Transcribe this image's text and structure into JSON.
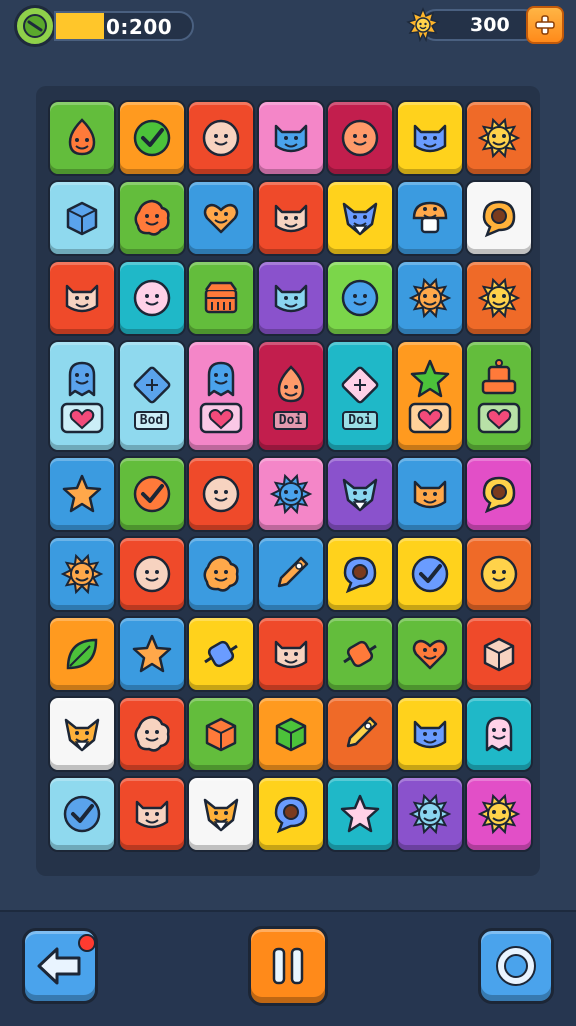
{
  "hud": {
    "timer_text": "0:200",
    "timer_progress": 0.35,
    "coins": "300"
  },
  "colors": {
    "green": "#63bd3c",
    "orange": "#ff9a1f",
    "red": "#ef4a2a",
    "pink": "#f486c8",
    "crimson": "#c21e4d",
    "yellow": "#ffd21c",
    "darkorange": "#ef6a28",
    "lightblue": "#8fd9ee",
    "blue": "#3b9be0",
    "white": "#f7f7f7",
    "teal": "#1fb8c8",
    "purple": "#8a52cc",
    "lime": "#7bd64a",
    "magenta": "#e24fc7"
  },
  "board": {
    "rows": [
      [
        {
          "c": "green",
          "i": "flame"
        },
        {
          "c": "orange",
          "i": "check"
        },
        {
          "c": "red",
          "i": "smile"
        },
        {
          "c": "pink",
          "i": "cat"
        },
        {
          "c": "crimson",
          "i": "smile"
        },
        {
          "c": "yellow",
          "i": "cat"
        },
        {
          "c": "darkorange",
          "i": "sun"
        }
      ],
      [
        {
          "c": "lightblue",
          "i": "box"
        },
        {
          "c": "green",
          "i": "blob"
        },
        {
          "c": "blue",
          "i": "heart"
        },
        {
          "c": "red",
          "i": "cat"
        },
        {
          "c": "yellow",
          "i": "fox"
        },
        {
          "c": "blue",
          "i": "mushroom"
        },
        {
          "c": "white",
          "i": "bubble"
        }
      ],
      [
        {
          "c": "red",
          "i": "cat"
        },
        {
          "c": "teal",
          "i": "smile"
        },
        {
          "c": "green",
          "i": "chest"
        },
        {
          "c": "purple",
          "i": "cat"
        },
        {
          "c": "lime",
          "i": "smile"
        },
        {
          "c": "blue",
          "i": "sun"
        },
        {
          "c": "darkorange",
          "i": "sun"
        }
      ],
      [
        {
          "c": "lightblue",
          "i": "ghost",
          "tall": true,
          "lbl": "heart"
        },
        {
          "c": "lightblue",
          "i": "diamond",
          "tall": true,
          "lbl": "text",
          "t": "Bod"
        },
        {
          "c": "pink",
          "i": "ghost",
          "tall": true,
          "lbl": "heart"
        },
        {
          "c": "crimson",
          "i": "flame",
          "tall": true,
          "lbl": "text",
          "t": "Doi"
        },
        {
          "c": "teal",
          "i": "diamond",
          "tall": true,
          "lbl": "text",
          "t": "Doi"
        },
        {
          "c": "orange",
          "i": "star",
          "tall": true,
          "lbl": "heart"
        },
        {
          "c": "green",
          "i": "robot",
          "tall": true,
          "lbl": "heart"
        }
      ],
      [
        {
          "c": "blue",
          "i": "star"
        },
        {
          "c": "green",
          "i": "check"
        },
        {
          "c": "red",
          "i": "smile"
        },
        {
          "c": "pink",
          "i": "sun"
        },
        {
          "c": "purple",
          "i": "fox"
        },
        {
          "c": "blue",
          "i": "cat"
        },
        {
          "c": "magenta",
          "i": "bubble"
        }
      ],
      [
        {
          "c": "blue",
          "i": "sun"
        },
        {
          "c": "red",
          "i": "smile"
        },
        {
          "c": "blue",
          "i": "blob"
        },
        {
          "c": "blue",
          "i": "rocket"
        },
        {
          "c": "yellow",
          "i": "bubble"
        },
        {
          "c": "yellow",
          "i": "check"
        },
        {
          "c": "darkorange",
          "i": "smile"
        }
      ],
      [
        {
          "c": "orange",
          "i": "leaf"
        },
        {
          "c": "blue",
          "i": "star"
        },
        {
          "c": "yellow",
          "i": "candy"
        },
        {
          "c": "red",
          "i": "cat"
        },
        {
          "c": "green",
          "i": "candy"
        },
        {
          "c": "green",
          "i": "heart"
        },
        {
          "c": "red",
          "i": "box"
        }
      ],
      [
        {
          "c": "white",
          "i": "fox"
        },
        {
          "c": "red",
          "i": "blob"
        },
        {
          "c": "green",
          "i": "box"
        },
        {
          "c": "orange",
          "i": "box"
        },
        {
          "c": "darkorange",
          "i": "rocket"
        },
        {
          "c": "yellow",
          "i": "cat"
        },
        {
          "c": "teal",
          "i": "ghost"
        }
      ],
      [
        {
          "c": "lightblue",
          "i": "check"
        },
        {
          "c": "red",
          "i": "cat"
        },
        {
          "c": "white",
          "i": "fox"
        },
        {
          "c": "yellow",
          "i": "bubble"
        },
        {
          "c": "teal",
          "i": "star"
        },
        {
          "c": "purple",
          "i": "sun"
        },
        {
          "c": "magenta",
          "i": "sun"
        }
      ]
    ]
  },
  "buttons": {
    "back": "back-arrow-icon",
    "pause": "pause-icon",
    "shuffle": "ring-icon"
  }
}
